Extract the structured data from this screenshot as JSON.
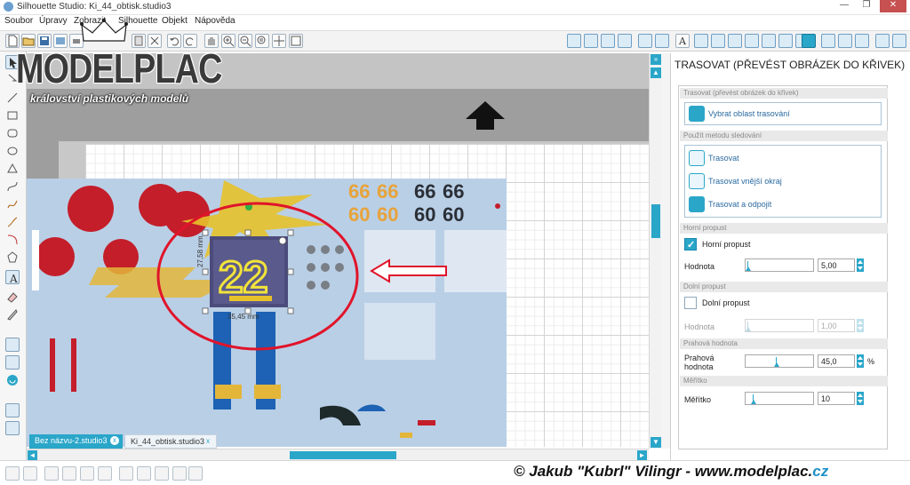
{
  "window": {
    "title": "Silhouette Studio: Ki_44_obtisk.studio3",
    "minimize": "—",
    "maximize": "❐",
    "close": "✕"
  },
  "menu": [
    "Soubor",
    "Úpravy",
    "Zobrazit",
    "Silhouette",
    "Objekt",
    "Nápověda"
  ],
  "watermark": {
    "brand": "MODELPLAC",
    "tagline": "království plastikových modelů"
  },
  "canvas": {
    "decal_numbers": [
      "66",
      "66",
      "66",
      "66",
      "60",
      "60",
      "60",
      "60",
      "22"
    ],
    "selection_width": "35,45 mm",
    "selection_height": "27,58 mm"
  },
  "tabs": [
    {
      "label": "Bez názvu-2.studio3",
      "active": true
    },
    {
      "label": "Ki_44_obtisk.studio3",
      "active": false
    }
  ],
  "tab_close": "x",
  "panel": {
    "title": "TRASOVAT (PŘEVÉST OBRÁZEK DO KŘIVEK)",
    "sec_trace": "Trasovat (převést obrázek do křivek)",
    "btn_select_area": "Vybrat oblast trasování",
    "sec_method": "Použít metodu sledování",
    "btn_trace": "Trasovat",
    "btn_trace_outer": "Trasovat vnější okraj",
    "btn_trace_detach": "Trasovat a odpojit",
    "sec_highpass": "Horní propust",
    "chk_highpass": "Horní propust",
    "highpass_checked": true,
    "lbl_value1": "Hodnota",
    "highpass_value": "5,00",
    "sec_lowpass": "Dolní propust",
    "chk_lowpass": "Dolní propust",
    "lowpass_checked": false,
    "lbl_value2": "Hodnota",
    "lowpass_value": "1,00",
    "sec_threshold": "Prahová hodnota",
    "lbl_threshold_1": "Prahová",
    "lbl_threshold_2": "hodnota",
    "threshold_value": "45,0",
    "threshold_unit": "%",
    "sec_scale": "Měřítko",
    "lbl_scale": "Měřítko",
    "scale_value": "10"
  },
  "scroll_arrows": {
    "up": "▲",
    "down": "▼",
    "left": "◄",
    "right": "►",
    "expand": "»"
  },
  "credit": {
    "prefix": "© Jakub \"Kubrl\" Vilingr - www.modelplac.",
    "suffix": "cz"
  },
  "accent_color": "#2aa6c9"
}
